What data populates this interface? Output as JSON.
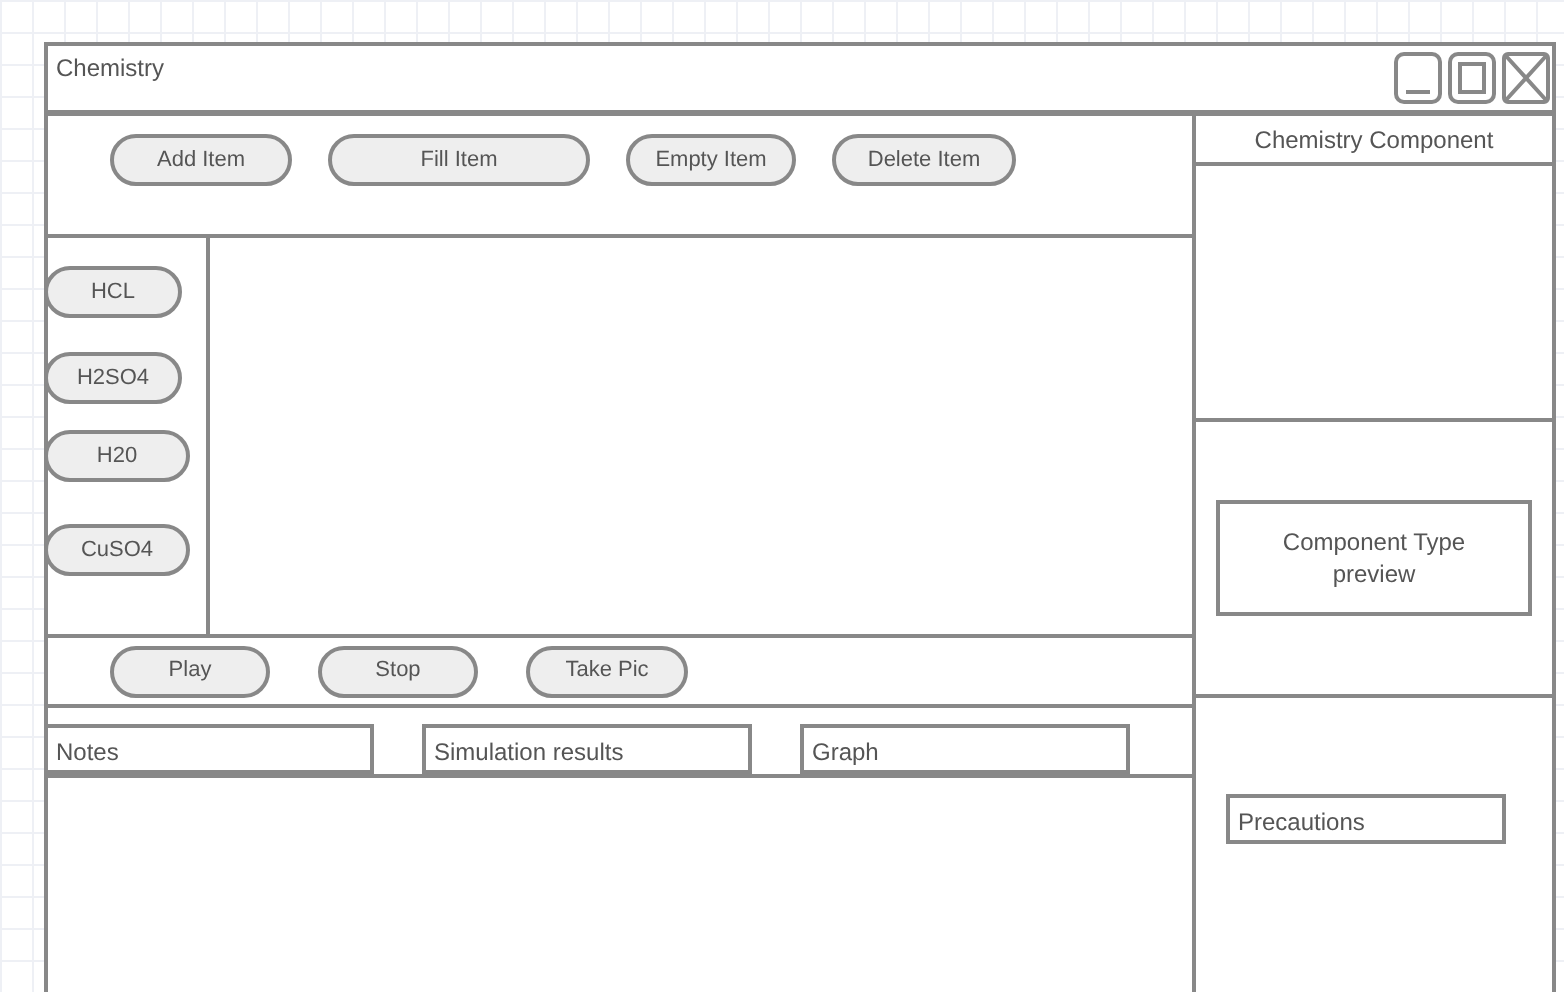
{
  "window": {
    "title": "Chemistry"
  },
  "toolbar": {
    "buttons": [
      "Add Item",
      "Fill Item",
      "Empty Item",
      "Delete Item"
    ]
  },
  "reagents": [
    "HCL",
    "H2SO4",
    "H20",
    "CuSO4"
  ],
  "playback": {
    "buttons": [
      "Play",
      "Stop",
      "Take Pic"
    ]
  },
  "output_fields": [
    "Notes",
    "Simulation results",
    "Graph"
  ],
  "component_panel": {
    "title": "Chemistry Component",
    "preview": "Component Type preview",
    "precautions": "Precautions"
  }
}
